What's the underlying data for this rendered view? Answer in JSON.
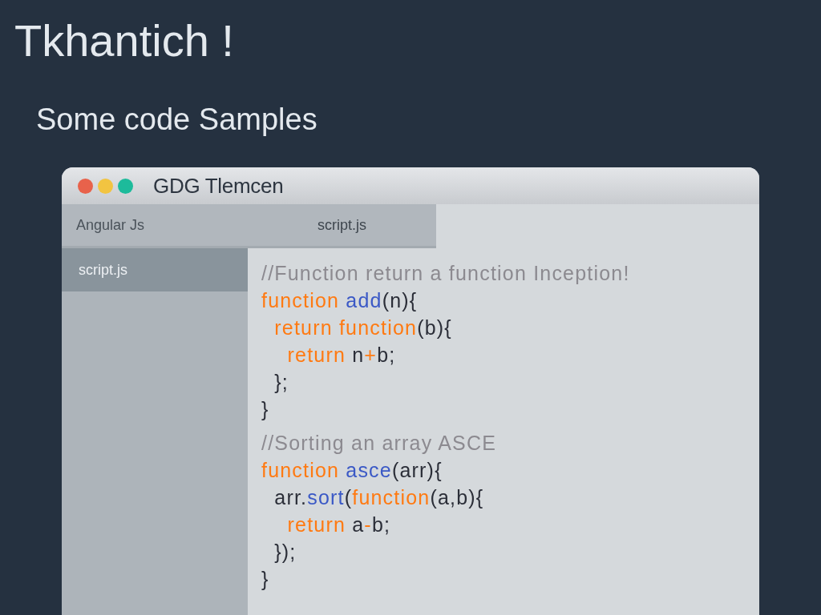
{
  "slide": {
    "title": "Tkhantich !",
    "subtitle": "Some code Samples"
  },
  "window": {
    "controls": [
      {
        "color": "#e8624b"
      },
      {
        "color": "#f2c441"
      },
      {
        "color": "#1dbb9b"
      }
    ],
    "title": "GDG Tlemcen"
  },
  "tabs": [
    {
      "label": "script.js",
      "selected": true
    }
  ],
  "sidebar": {
    "header": "Angular Js",
    "items": [
      {
        "label": "script.js",
        "selected": true
      }
    ]
  },
  "editor": {
    "code_blocks": [
      {
        "lines": [
          {
            "tokens": [
              {
                "kind": "comment",
                "text": "//Function return a function Inception!"
              }
            ]
          },
          {
            "tokens": [
              {
                "kind": "keyword",
                "text": "function "
              },
              {
                "kind": "name",
                "text": "add"
              },
              {
                "kind": "plain",
                "text": "(n){"
              }
            ]
          },
          {
            "tokens": [
              {
                "kind": "keyword",
                "text": "  return function"
              },
              {
                "kind": "plain",
                "text": "(b){"
              }
            ]
          },
          {
            "tokens": [
              {
                "kind": "keyword",
                "text": "    return "
              },
              {
                "kind": "plain",
                "text": "n"
              },
              {
                "kind": "operator",
                "text": "+"
              },
              {
                "kind": "plain",
                "text": "b;"
              }
            ]
          },
          {
            "tokens": [
              {
                "kind": "plain",
                "text": "  };"
              }
            ]
          },
          {
            "tokens": [
              {
                "kind": "plain",
                "text": "}"
              }
            ]
          }
        ]
      },
      {
        "lines": [
          {
            "tokens": [
              {
                "kind": "comment",
                "text": "//Sorting an array ASCE"
              }
            ]
          },
          {
            "tokens": [
              {
                "kind": "keyword",
                "text": "function "
              },
              {
                "kind": "name",
                "text": "asce"
              },
              {
                "kind": "plain",
                "text": "(arr){"
              }
            ]
          },
          {
            "tokens": [
              {
                "kind": "plain",
                "text": "  arr."
              },
              {
                "kind": "name",
                "text": "sort"
              },
              {
                "kind": "plain",
                "text": "("
              },
              {
                "kind": "keyword",
                "text": "function"
              },
              {
                "kind": "plain",
                "text": "(a,b){"
              }
            ]
          },
          {
            "tokens": [
              {
                "kind": "keyword",
                "text": "    return "
              },
              {
                "kind": "plain",
                "text": "a"
              },
              {
                "kind": "operator",
                "text": "-"
              },
              {
                "kind": "plain",
                "text": "b;"
              }
            ]
          },
          {
            "tokens": [
              {
                "kind": "plain",
                "text": "  });"
              }
            ]
          },
          {
            "tokens": [
              {
                "kind": "plain",
                "text": "}"
              }
            ]
          }
        ]
      }
    ]
  }
}
